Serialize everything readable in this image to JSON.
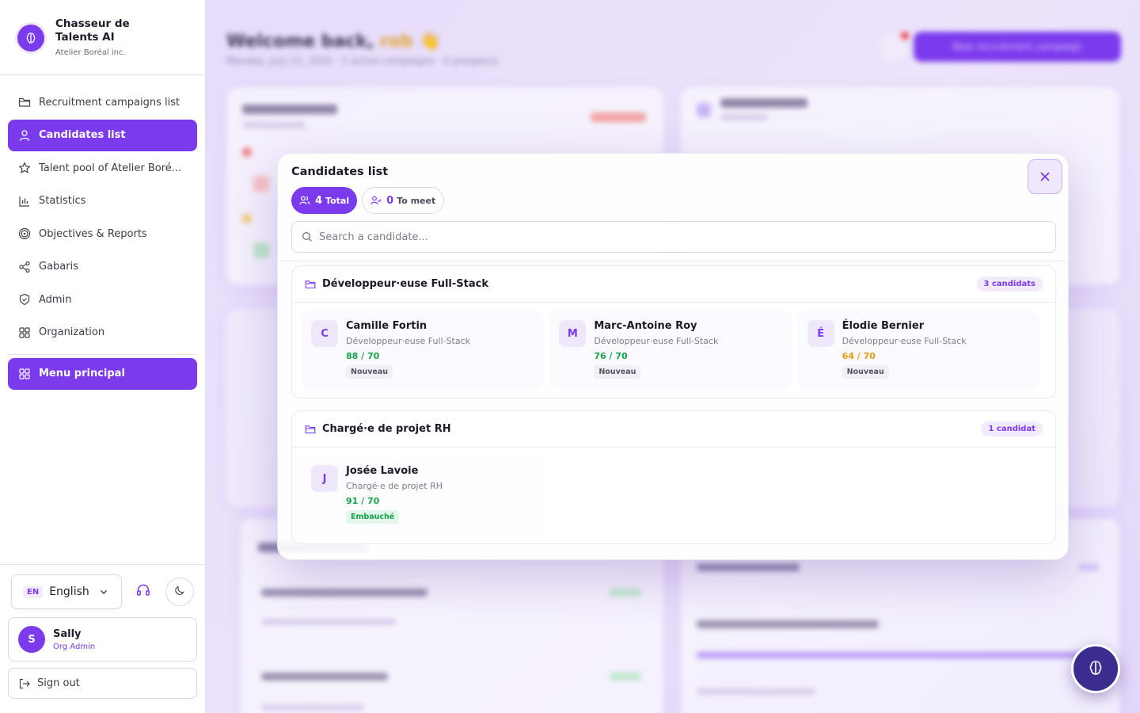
{
  "brand": {
    "name": "Chasseur de Talents AI",
    "org": "Atelier Boréal inc."
  },
  "nav": {
    "items": [
      {
        "label": "Recruitment campaigns list",
        "icon": "folder-icon",
        "active": false
      },
      {
        "label": "Candidates list",
        "icon": "user-icon",
        "active": true
      },
      {
        "label": "Talent pool of Atelier Boré...",
        "icon": "star-icon",
        "active": false
      },
      {
        "label": "Statistics",
        "icon": "bar-chart-icon",
        "active": false
      },
      {
        "label": "Objectives & Reports",
        "icon": "target-icon",
        "active": false
      },
      {
        "label": "Gabaris",
        "icon": "share-icon",
        "active": false
      },
      {
        "label": "Admin",
        "icon": "shield-icon",
        "active": false
      },
      {
        "label": "Organization",
        "icon": "grid-icon",
        "active": false
      }
    ],
    "main_menu": "Menu principal"
  },
  "language": {
    "code": "EN",
    "name": "English"
  },
  "user": {
    "initial": "S",
    "name": "Sally",
    "role": "Org Admin"
  },
  "sign_out": "Sign out",
  "background": {
    "cta": "New recruitment campaign"
  },
  "modal": {
    "title": "Candidates list",
    "pills": {
      "total_count": "4",
      "total_label": "Total",
      "meet_count": "0",
      "meet_label": "To meet"
    },
    "search_placeholder": "Search a candidate...",
    "groups": [
      {
        "title": "Développeur·euse Full-Stack",
        "count": "3 candidats",
        "candidates": [
          {
            "initial": "C",
            "name": "Camille Fortin",
            "role": "Développeur·euse Full-Stack",
            "score": "88 / 70",
            "score_color": "#16a34a",
            "status": "Nouveau",
            "status_type": "new"
          },
          {
            "initial": "M",
            "name": "Marc-Antoine Roy",
            "role": "Développeur·euse Full-Stack",
            "score": "76 / 70",
            "score_color": "#16a34a",
            "status": "Nouveau",
            "status_type": "new"
          },
          {
            "initial": "É",
            "name": "Élodie Bernier",
            "role": "Développeur·euse Full-Stack",
            "score": "64 / 70",
            "score_color": "#e59a0f",
            "status": "Nouveau",
            "status_type": "new"
          }
        ]
      },
      {
        "title": "Chargé·e de projet RH",
        "count": "1 candidat",
        "candidates": [
          {
            "initial": "J",
            "name": "Josée Lavoie",
            "role": "Chargé·e de projet RH",
            "score": "91 / 70",
            "score_color": "#16a34a",
            "status": "Embauché",
            "status_type": "hired"
          }
        ]
      }
    ]
  },
  "colors": {
    "accent": "#7c3aed",
    "success": "#16a34a",
    "warning": "#e59a0f"
  }
}
